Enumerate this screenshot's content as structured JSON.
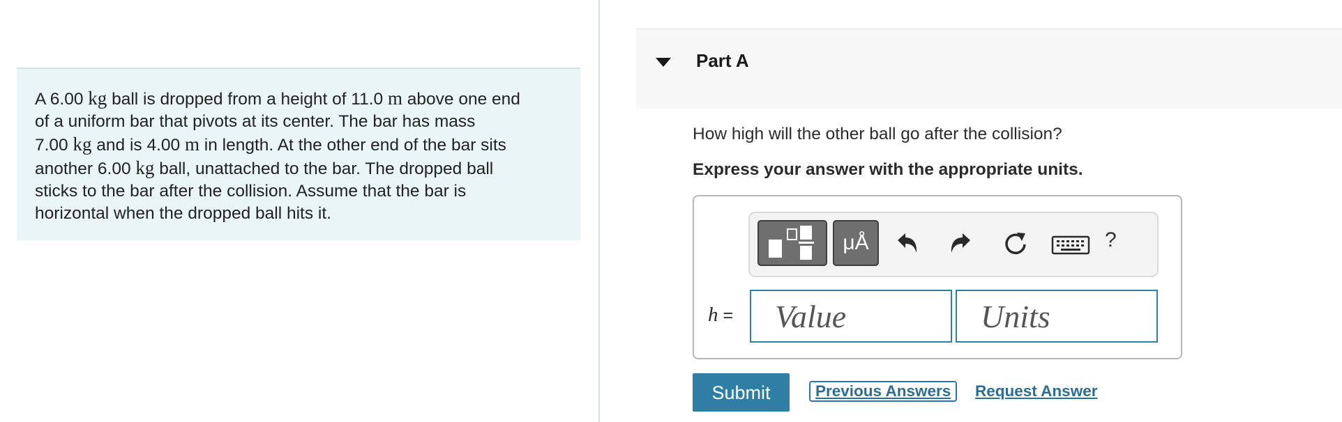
{
  "problem": {
    "lines": [
      [
        "A 6.00 ",
        "kg",
        " ball is dropped from a height of 11.0 ",
        "m",
        " above one end"
      ],
      [
        "of a uniform bar that pivots at its center. The bar has mass"
      ],
      [
        "7.00 ",
        "kg",
        " and is 4.00 ",
        "m",
        " in length. At the other end of the bar sits"
      ],
      [
        "another 6.00 ",
        "kg",
        " ball, unattached to the bar. The dropped ball"
      ],
      [
        "sticks to the bar after the collision. Assume that the bar is"
      ],
      [
        "horizontal when the dropped ball hits it."
      ]
    ]
  },
  "part": {
    "title": "Part A"
  },
  "question": "How high will the other ball go after the collision?",
  "instruction": "Express your answer with the appropriate units.",
  "answer": {
    "variable": "h",
    "equals": "=",
    "value_placeholder": "Value",
    "units_placeholder": "Units",
    "value": "",
    "units": ""
  },
  "toolbar": {
    "units_tool_label": "μÅ",
    "help_label": "?",
    "icons": [
      "templates-icon",
      "units-icon",
      "undo-icon",
      "redo-icon",
      "reset-icon",
      "keyboard-icon",
      "help-icon"
    ]
  },
  "actions": {
    "submit_label": "Submit",
    "previous_answers_label": "Previous Answers",
    "request_answer_label": "Request Answer"
  },
  "colors": {
    "problem_bg": "#e9f5f7",
    "accent": "#2f7ea3",
    "link": "#2b6e93"
  }
}
